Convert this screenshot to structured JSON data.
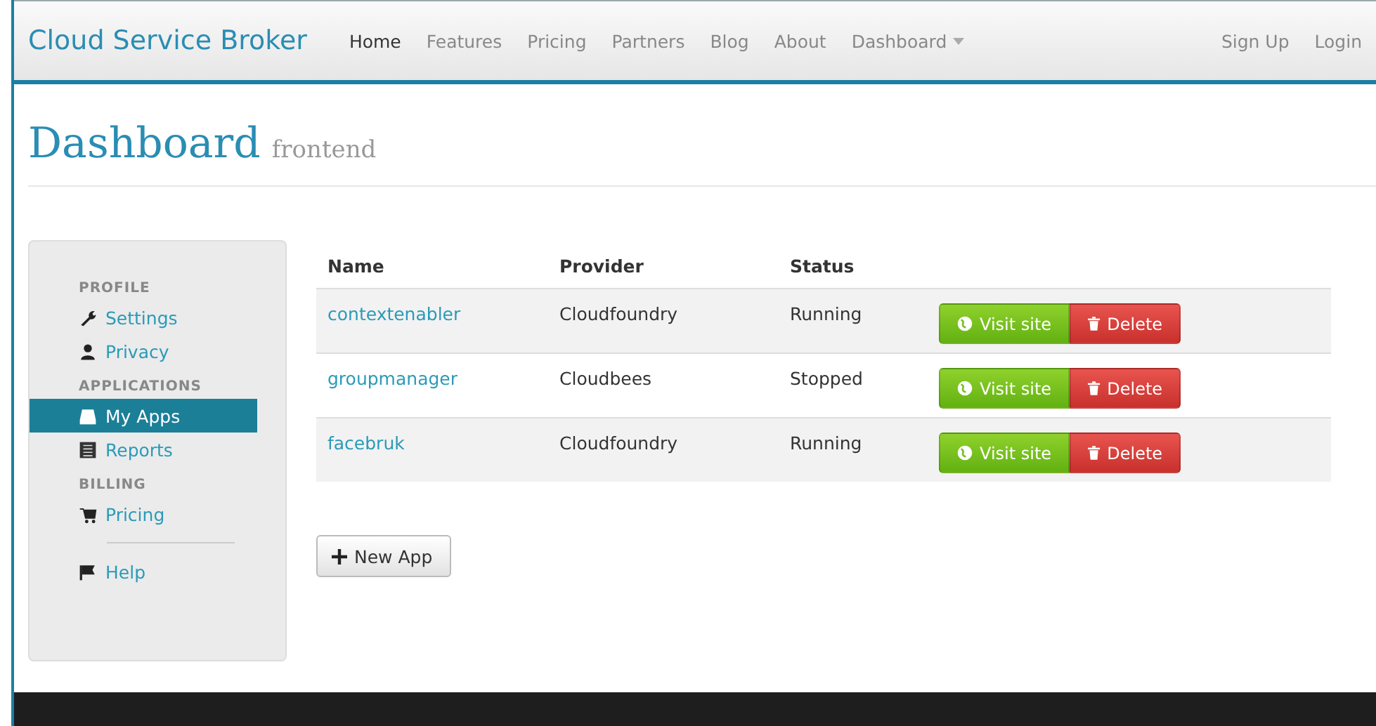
{
  "navbar": {
    "brand": "Cloud Service Broker",
    "items": [
      {
        "label": "Home",
        "selected": true
      },
      {
        "label": "Features",
        "selected": false
      },
      {
        "label": "Pricing",
        "selected": false
      },
      {
        "label": "Partners",
        "selected": false
      },
      {
        "label": "Blog",
        "selected": false
      },
      {
        "label": "About",
        "selected": false
      },
      {
        "label": "Dashboard",
        "selected": false,
        "dropdown": true
      }
    ],
    "right_items": [
      "Sign Up",
      "Login"
    ]
  },
  "page_header": {
    "title": "Dashboard",
    "subtitle": "frontend"
  },
  "sidebar": {
    "items": [
      {
        "kind": "header",
        "label": "PROFILE"
      },
      {
        "kind": "link",
        "label": "Settings",
        "selected": false
      },
      {
        "kind": "link",
        "label": "Privacy",
        "selected": false
      },
      {
        "kind": "header",
        "label": "APPLICATIONS"
      },
      {
        "kind": "link",
        "label": "My Apps",
        "selected": true
      },
      {
        "kind": "link",
        "label": "Reports",
        "selected": false
      },
      {
        "kind": "header",
        "label": "BILLING"
      },
      {
        "kind": "link",
        "label": "Pricing",
        "selected": false
      },
      {
        "kind": "divider"
      },
      {
        "kind": "link",
        "label": "Help",
        "selected": false
      }
    ]
  },
  "table": {
    "columns": [
      "Name",
      "Provider",
      "Status"
    ],
    "rows": [
      {
        "name": "contextenabler",
        "provider": "Cloudfoundry",
        "status": "Running",
        "actions": [
          "Visit site",
          "Delete"
        ]
      },
      {
        "name": "groupmanager",
        "provider": "Cloudbees",
        "status": "Stopped",
        "actions": [
          "Visit site",
          "Delete"
        ]
      },
      {
        "name": "facebruk",
        "provider": "Cloudfoundry",
        "status": "Running",
        "actions": [
          "Visit site",
          "Delete"
        ]
      }
    ]
  },
  "new_app_button": "New App"
}
